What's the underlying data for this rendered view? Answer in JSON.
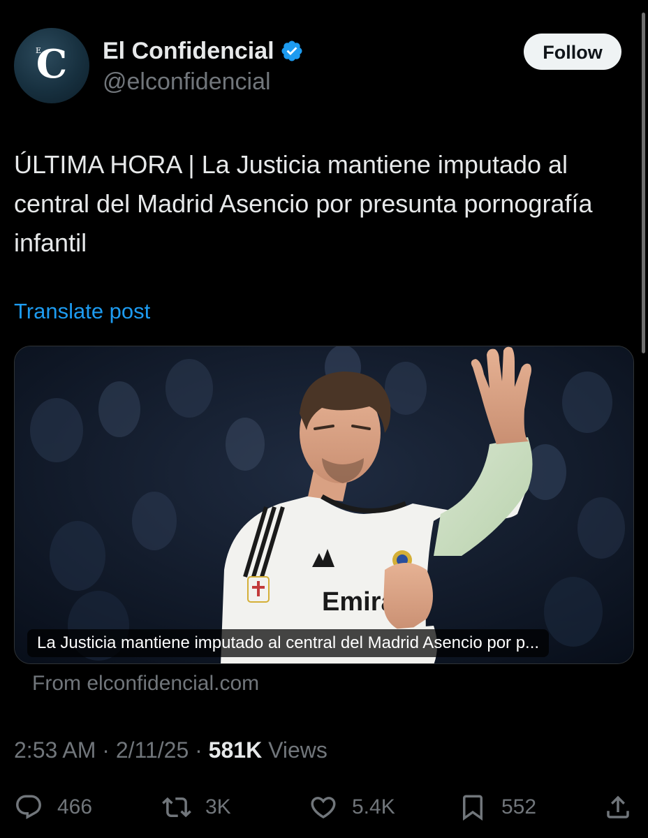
{
  "author": {
    "display_name": "El Confidencial",
    "handle": "@elconfidencial",
    "avatar_letter": "C",
    "avatar_small_letter": "E",
    "verified": true
  },
  "follow_label": "Follow",
  "tweet": {
    "text": "ÚLTIMA HORA | La Justicia mantiene imputado al central del Madrid Asencio por presunta pornografía infantil",
    "translate_label": "Translate post"
  },
  "card": {
    "caption": "La Justicia mantiene imputado al central del Madrid Asencio por p...",
    "source": "From elconfidencial.com",
    "jersey_text": "Emira"
  },
  "meta": {
    "time": "2:53 AM",
    "date": "2/11/25",
    "views_count": "581K",
    "views_label": "Views",
    "separator": "·"
  },
  "actions": {
    "replies": "466",
    "reposts": "3K",
    "likes": "5.4K",
    "bookmarks": "552"
  },
  "colors": {
    "background": "#000000",
    "text_primary": "#e7e9ea",
    "text_secondary": "#71767b",
    "link": "#1d9bf0",
    "verified_badge": "#1d9bf0",
    "follow_button_bg": "#eff3f4"
  }
}
